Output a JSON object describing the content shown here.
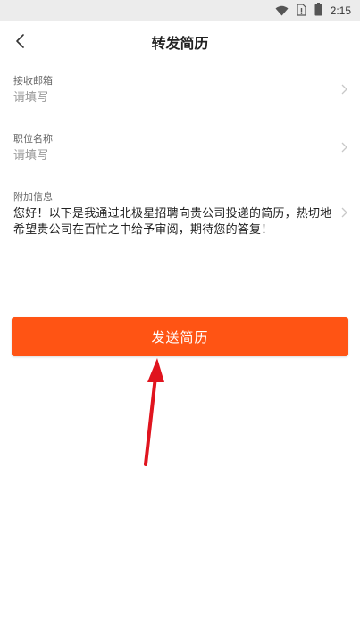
{
  "status_bar": {
    "time": "2:15",
    "icons": [
      "wifi-icon",
      "sim-card-icon",
      "battery-icon"
    ]
  },
  "nav": {
    "title": "转发简历",
    "back_icon": "chevron-left-icon"
  },
  "form": {
    "fields": [
      {
        "label": "接收邮箱",
        "placeholder": "请填写"
      },
      {
        "label": "职位名称",
        "placeholder": "请填写"
      },
      {
        "label": "附加信息",
        "value": "您好！以下是我通过北极星招聘向贵公司投递的简历，热切地希望贵公司在百忙之中给予审阅，期待您的答复！"
      }
    ]
  },
  "submit_button": {
    "label": "发送简历",
    "color": "#ff5414"
  },
  "annotation": {
    "arrow_color": "#e0141e"
  }
}
